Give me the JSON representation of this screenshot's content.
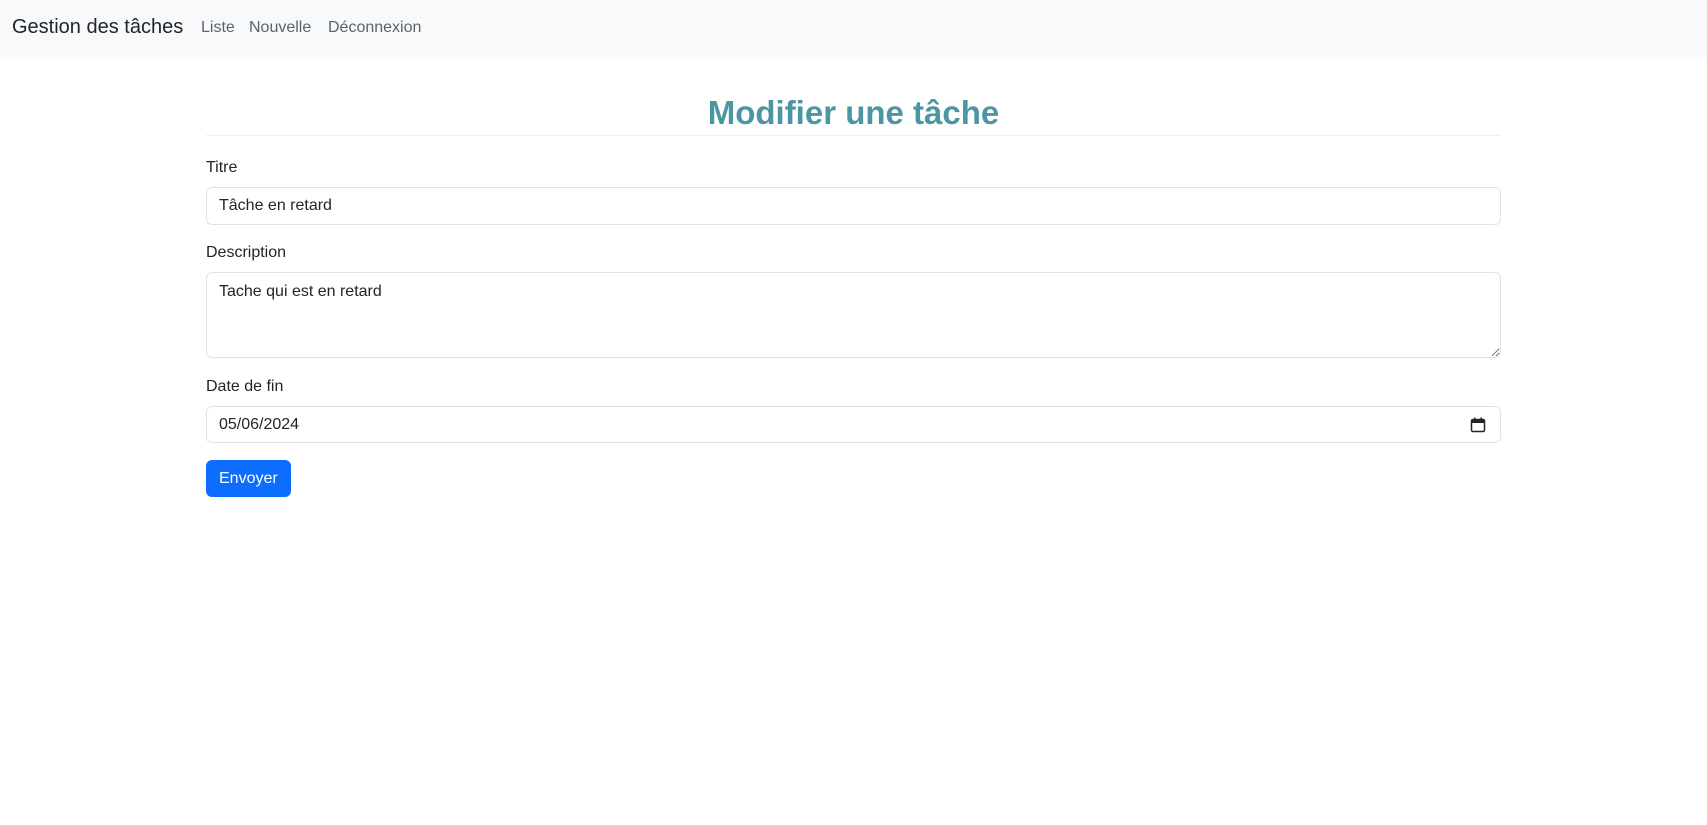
{
  "navbar": {
    "brand": "Gestion des tâches",
    "links": [
      {
        "label": "Liste"
      },
      {
        "label": "Nouvelle"
      },
      {
        "label": "Déconnexion"
      }
    ]
  },
  "page": {
    "title": "Modifier une tâche"
  },
  "form": {
    "titre": {
      "label": "Titre",
      "value": "Tâche en retard"
    },
    "description": {
      "label": "Description",
      "value": "Tache qui est en retard"
    },
    "date_fin": {
      "label": "Date de fin",
      "value": "05/06/2024",
      "icon": "calendar-icon"
    },
    "submit_label": "Envoyer"
  },
  "colors": {
    "navbar_bg": "#f8f9fa",
    "title": "#4c95a2",
    "primary": "#0d6efd"
  }
}
